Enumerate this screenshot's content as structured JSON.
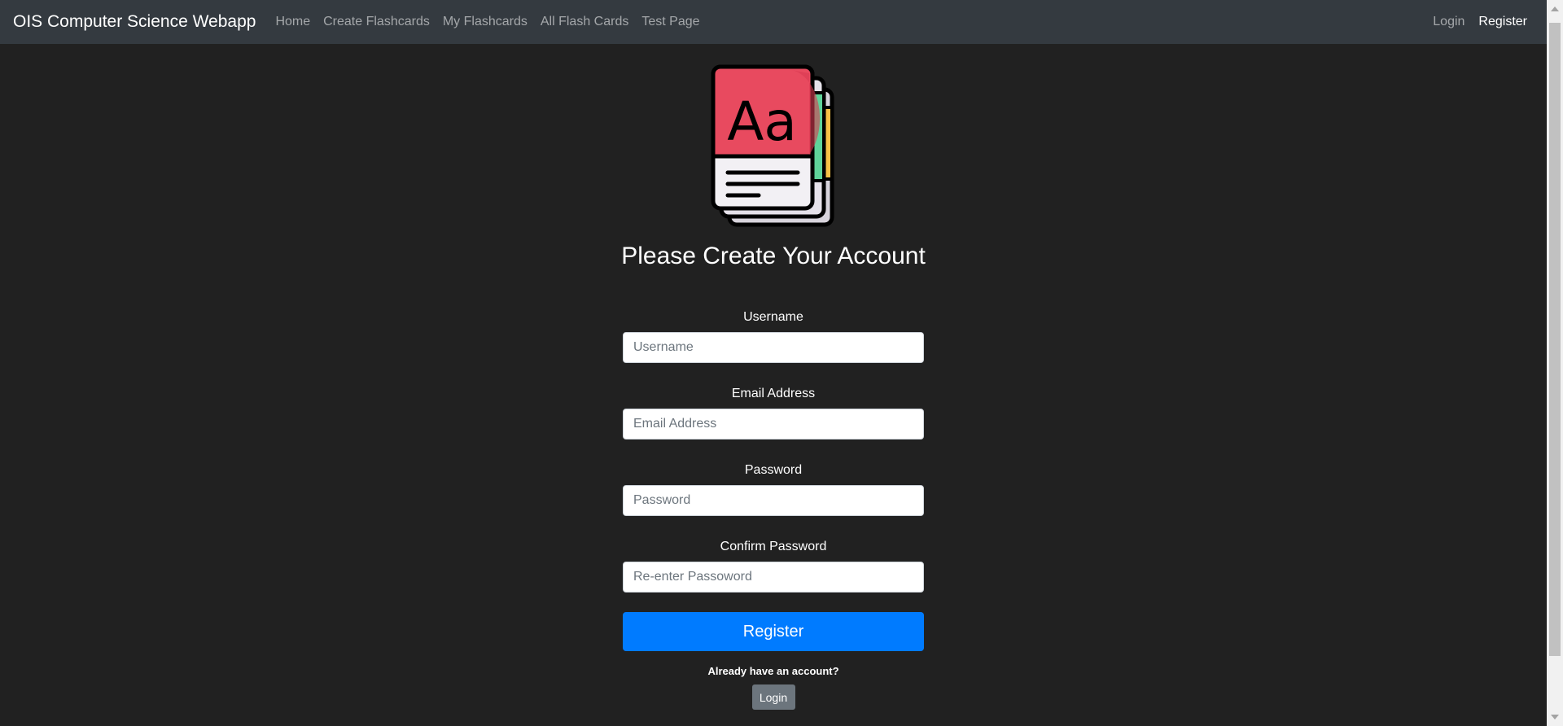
{
  "navbar": {
    "brand": "OIS Computer Science Webapp",
    "links": [
      {
        "label": "Home"
      },
      {
        "label": "Create Flashcards"
      },
      {
        "label": "My Flashcards"
      },
      {
        "label": "All Flash Cards"
      },
      {
        "label": "Test Page"
      }
    ],
    "right_links": [
      {
        "label": "Login"
      },
      {
        "label": "Register"
      }
    ]
  },
  "logo": {
    "icon": "flashcards-logo-icon",
    "glyph": "Aa"
  },
  "main": {
    "title": "Please Create Your Account",
    "fields": [
      {
        "label": "Username",
        "placeholder": "Username"
      },
      {
        "label": "Email Address",
        "placeholder": "Email Address"
      },
      {
        "label": "Password",
        "placeholder": "Password"
      },
      {
        "label": "Confirm Password",
        "placeholder": "Re-enter Passoword"
      }
    ],
    "register_button": "Register",
    "already_text": "Already have an account?",
    "login_button": "Login"
  },
  "colors": {
    "background": "#212121",
    "navbar": "#343a40",
    "primary": "#007bff",
    "secondary": "#6c757d",
    "logo_red": "#e84a5f",
    "logo_green": "#5fd39a",
    "logo_yellow": "#f8c146"
  }
}
